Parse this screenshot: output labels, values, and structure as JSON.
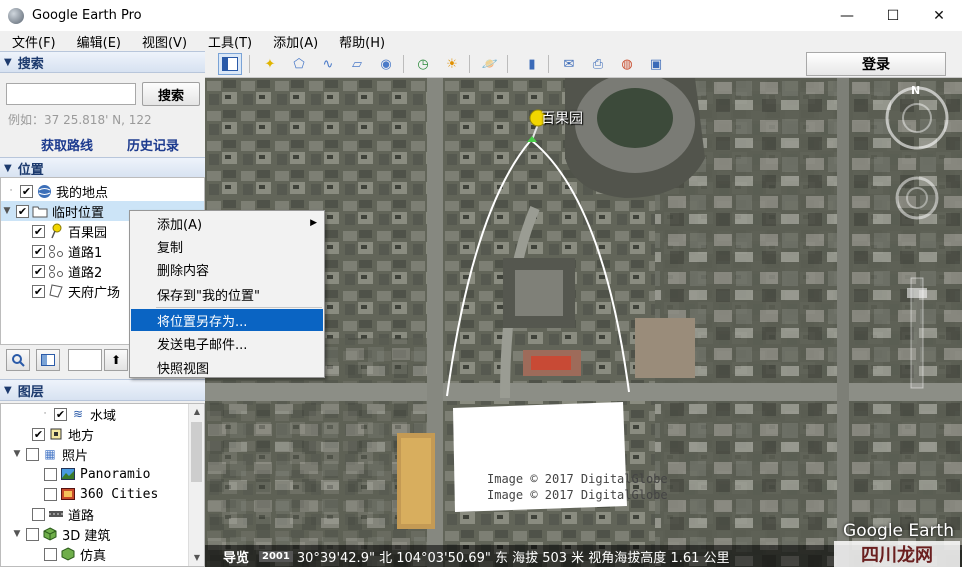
{
  "window": {
    "title": "Google Earth Pro",
    "controls": [
      "—",
      "☐",
      "✕"
    ]
  },
  "menu": [
    "文件(F)",
    "编辑(E)",
    "视图(V)",
    "工具(T)",
    "添加(A)",
    "帮助(H)"
  ],
  "search": {
    "header": "搜索",
    "button": "搜索",
    "hint": "例如：37 25.818' N, 122",
    "link_route": "获取路线",
    "link_history": "历史记录"
  },
  "places": {
    "header": "位置",
    "items": [
      {
        "label": "我的地点",
        "checked": true,
        "icon": "globe-icon"
      },
      {
        "label": "临时位置",
        "checked": true,
        "icon": "folder-icon"
      },
      {
        "label": "百果园",
        "checked": true,
        "icon": "pushpin-icon"
      },
      {
        "label": "道路1",
        "checked": true,
        "icon": "path-icon"
      },
      {
        "label": "道路2",
        "checked": true,
        "icon": "path-icon"
      },
      {
        "label": "天府广场",
        "checked": true,
        "icon": "polygon-icon"
      }
    ]
  },
  "layers": {
    "header": "图层",
    "items": [
      {
        "label": "水域",
        "checked": true
      },
      {
        "label": "地方",
        "checked": true
      },
      {
        "label": "照片",
        "checked": false
      },
      {
        "label": "Panoramio",
        "checked": false
      },
      {
        "label": "360 Cities",
        "checked": false
      },
      {
        "label": "道路",
        "checked": false
      },
      {
        "label": "3D 建筑",
        "checked": false
      },
      {
        "label": "仿真",
        "checked": false
      }
    ]
  },
  "context_menu": {
    "items": [
      "添加(A)",
      "复制",
      "删除内容",
      "保存到\"我的位置\"",
      "将位置另存为...",
      "发送电子邮件...",
      "快照视图"
    ],
    "highlighted": "将位置另存为..."
  },
  "toolbar": {
    "login": "登录"
  },
  "map": {
    "pin_label": "百果园",
    "watermark": "Image © 2017 DigitalGlobe",
    "brand": "Google Earth",
    "compass_n": "N",
    "site_mark": "四川龙网"
  },
  "status": {
    "nav": "导览",
    "year": "2001",
    "coords": "30°39'42.9\" 北 104°03'50.69\" 东 海拔   503 米   视角海拔高度   1.61 公里"
  }
}
